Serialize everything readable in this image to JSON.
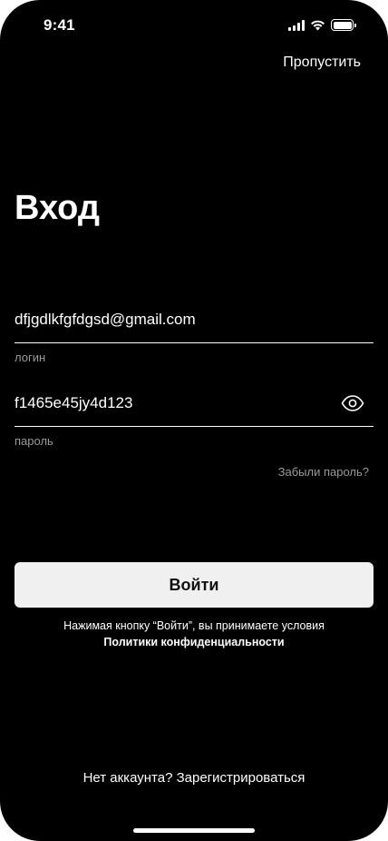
{
  "status_bar": {
    "time": "9:41",
    "signal_icon": "cellular-signal-icon",
    "wifi_icon": "wifi-icon",
    "battery_icon": "battery-icon",
    "battery_level": 1.0
  },
  "header": {
    "skip_label": "Пропустить"
  },
  "title": "Вход",
  "login": {
    "value": "dfjgdlkfgfdgsd@gmail.com",
    "label": "логин"
  },
  "password": {
    "value": "f1465e45jy4d123",
    "label": "пароль",
    "toggle_icon": "eye-icon"
  },
  "forgot_password_label": "Забыли пароль?",
  "submit_label": "Войти",
  "terms": {
    "text": "Нажимая кнопку “Войти”, вы принимаете условия",
    "link": "Политики конфиденциальности"
  },
  "register": {
    "prompt": "Нет аккаунта?",
    "link": "Зарегистрироваться"
  },
  "colors": {
    "background": "#000000",
    "text": "#ffffff",
    "muted": "#9a9a9a",
    "button_bg": "#f0f0f0",
    "button_text": "#111111"
  }
}
